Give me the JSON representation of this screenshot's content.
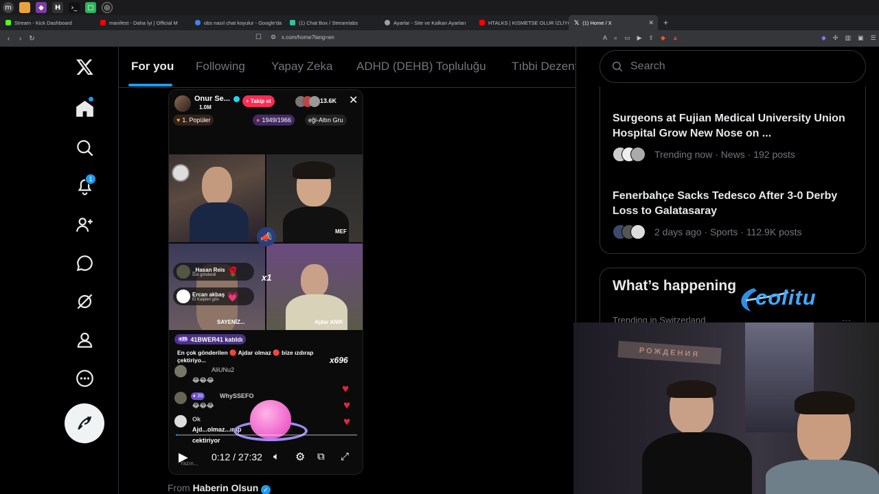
{
  "browser": {
    "tabs": [
      {
        "label": "Stream - Kick Dashboard",
        "color": "#53fc18"
      },
      {
        "label": "manifest - Daha İyi | Official M",
        "color": "#ff0000"
      },
      {
        "label": "obs nasıl chat koyulur - Google'da",
        "color": "#4285f4"
      },
      {
        "label": "(1) Chat Box / Streamlabs",
        "color": "#31c3a2"
      },
      {
        "label": "Ayarlar - Site ve Kalkan Ayarları",
        "color": "#9aa0a6"
      },
      {
        "label": "HTALKS | KISMETSE OLUR İZLİYO",
        "color": "#ff0000"
      },
      {
        "label": "(1) Home / X",
        "color": "#ffffff"
      }
    ],
    "url": "x.com/home?lang=en"
  },
  "nav": {
    "notification_count": "1"
  },
  "feed": {
    "tabs": [
      "For you",
      "Following",
      "Yapay Zeka",
      "ADHD (DEHB) Topluluğu",
      "Tıbbi Dezent"
    ],
    "from_prefix": "From",
    "from_name": "Haberin Olsun"
  },
  "video": {
    "streamer_name": "Onur Se...",
    "streamer_followers": "1.0M",
    "follow_label": "+ Takip et",
    "viewer_count": "13.6K",
    "popular_badge": "1. Popüler",
    "goal_progress": "1949/1966",
    "goal_label": "eği-Altın Gru",
    "guest_top_right": "MEF",
    "gift_sender_1": "_Hasan Reis",
    "gift_sender_1_sub": "Gül gönderdi",
    "gift_multiplier": "x1",
    "gift_sender_2": "Ercan akbaş",
    "gift_sender_2_sub": "El Kalpleri gön",
    "guest_bottom_left": "SAYENİZ...",
    "guest_bottom_right": "Ajdar ANIK",
    "join_level": "35",
    "join_text": "41BWER41 katıldı",
    "top_gift_text": "En çok gönderilen 🔴 Ajdar olmaz 🔴 bize ızdırap çektiriyo...",
    "top_gift_count": "x696",
    "chat_user_1": "AliUNu2",
    "chat_emojis": "😂😂😂",
    "chat_level_2": "20",
    "chat_user_2": "WhySSEFO",
    "chat_user_3": "Ok",
    "chat_line_4": "Ajd...olmaz...ırap",
    "chat_line_5": "cektiriyor",
    "chat_placeholder": "Yazın...",
    "time": "0:12 / 27:32",
    "progress": 0.007
  },
  "right": {
    "search_placeholder": "Search",
    "trends": [
      {
        "title": "Surgeons at Fujian Medical University Union Hospital Grow New Nose on ...",
        "meta": "Trending now · News · 192 posts"
      },
      {
        "title": "Fenerbahçe Sacks Tedesco After 3-0 Derby Loss to Galatasaray",
        "meta": "2 days ago · Sports · 112.9K posts"
      }
    ],
    "happening_title": "What’s happening",
    "happening_sub": "Trending in Switzerland"
  },
  "overlay": {
    "logo_text": "colitu",
    "banner_text": "РОЖДЕНИЯ"
  }
}
